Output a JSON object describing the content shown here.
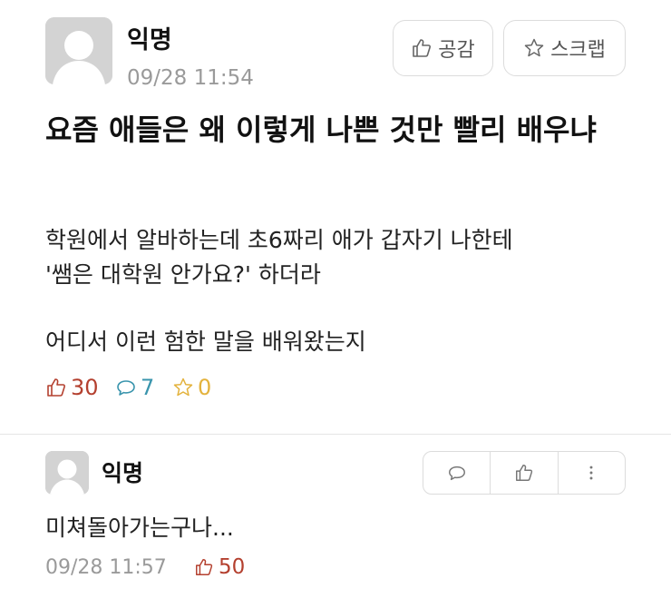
{
  "post": {
    "author": "익명",
    "time": "09/28 11:54",
    "like_button": "공감",
    "scrap_button": "스크랩",
    "title": "요즘 애들은 왜 이렇게 나쁜 것만 빨리 배우냐",
    "body_lines": [
      "학원에서 알바하는데 초6짜리 애가 갑자기 나한테",
      "'쌤은 대학원 안가요?' 하더라",
      "어디서 이런 험한 말을 배워왔는지"
    ],
    "stats": {
      "likes": "30",
      "comments": "7",
      "scraps": "0"
    }
  },
  "comment": {
    "author": "익명",
    "text": "미쳐돌아가는구나...",
    "time": "09/28 11:57",
    "likes": "50"
  },
  "icons": {
    "avatar": "default-avatar-icon",
    "like": "thumbs-up-icon",
    "comment": "speech-bubble-icon",
    "scrap": "star-icon",
    "more": "more-vertical-icon"
  },
  "colors": {
    "like": "#b4402f",
    "comment": "#3a95ad",
    "scrap": "#e3b23c",
    "muted": "#9a9a9a"
  }
}
